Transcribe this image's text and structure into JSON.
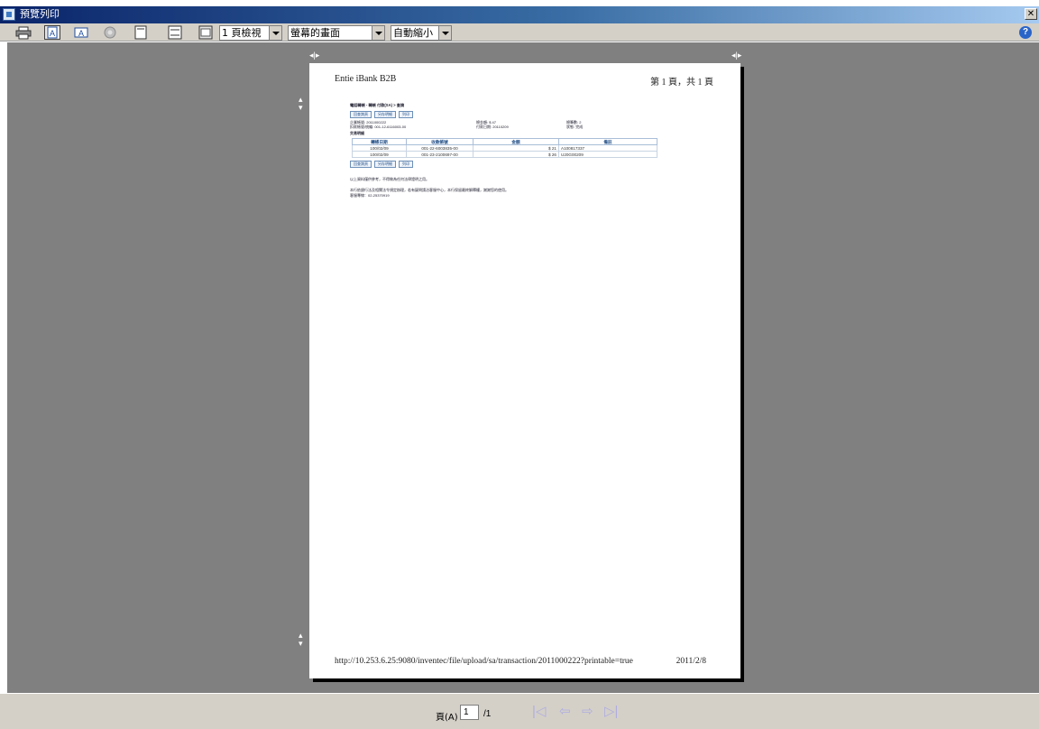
{
  "window": {
    "title": "預覽列印",
    "close_label": "✕"
  },
  "toolbar": {
    "view_mode": "1 頁檢視",
    "frames_mode": "螢幕的畫面",
    "zoom_mode": "自動縮小",
    "help_label": "?"
  },
  "page": {
    "header_left": "Entie iBank B2B",
    "header_right": "第 1 頁，共 1 頁",
    "breadcrumb": "電話轉帳 - 轉帳 付款(SA) > 查詢",
    "buttons": [
      "回查詢頁",
      "另存明細",
      "列印"
    ],
    "info": {
      "account": "企業帳號: 2011000222",
      "debit_account": "扣款帳號/統編: 001-12-6116003-00",
      "total_amount": "總金額: $ 47",
      "transfer_date": "付款日期: 20110209",
      "count": "總筆數: 2",
      "status": "狀態: 完成"
    },
    "tx_heading": "交易明細",
    "table": {
      "headers": [
        "轉帳日期",
        "收款帳號",
        "金額",
        "備註"
      ],
      "rows": [
        {
          "date": "100/02/09",
          "account": "001-22-6003835-00",
          "amount": "$ 21",
          "memo": "A100817337"
        },
        {
          "date": "100/02/09",
          "account": "001-23-2100697-00",
          "amount": "$ 26",
          "memo": "U20G00209"
        }
      ]
    },
    "note": "以上資料僅供參考，不得做為任何法律證明之用。",
    "disclaimer": "本行依銀行法及相關法令規定辦理，若有疑問請洽客服中心，本行保留最終解釋權，謝謝您的使用。",
    "hotline": "客服專線：02-25370919",
    "footer_url": "http://10.253.6.25:9080/inventec/file/upload/sa/transaction/2011000222?printable=true",
    "footer_date": "2011/2/8"
  },
  "statusbar": {
    "page_label": "頁(A)",
    "page_value": "1",
    "page_total": "/1",
    "nav_first": "|◁",
    "nav_prev": "⇦",
    "nav_next": "⇨",
    "nav_last": "▷|"
  }
}
